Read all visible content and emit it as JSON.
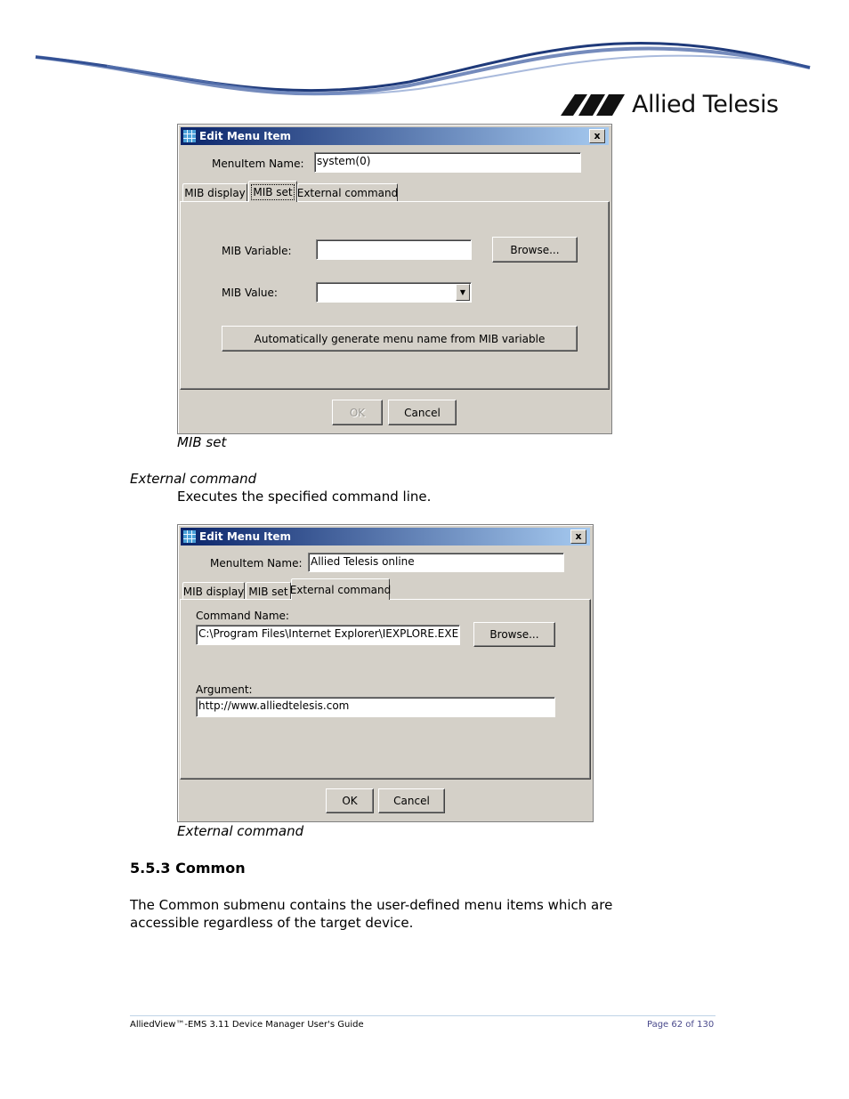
{
  "header": {
    "logo_text": "Allied Telesis"
  },
  "dialog1": {
    "title": "Edit Menu Item",
    "close_label": "x",
    "menuitem_label": "MenuItem Name:",
    "menuitem_value": "system(0)",
    "tabs": [
      "MIB display",
      "MIB set",
      "External command"
    ],
    "active_tab": "MIB set",
    "mib_variable_label": "MIB Variable:",
    "mib_variable_value": "",
    "browse_label": "Browse...",
    "mib_value_label": "MIB Value:",
    "mib_value_value": "",
    "auto_generate_label": "Automatically generate menu name from MIB variable",
    "ok_label": "OK",
    "cancel_label": "Cancel"
  },
  "caption1": "MIB set",
  "term": "External command",
  "term_description": "Executes the specified command line.",
  "dialog2": {
    "title": "Edit Menu Item",
    "close_label": "x",
    "menuitem_label": "MenuItem Name:",
    "menuitem_value": "Allied Telesis online",
    "tabs": [
      "MIB display",
      "MIB set",
      "External command"
    ],
    "active_tab": "External command",
    "command_name_label": "Command Name:",
    "command_name_value": "C:\\Program Files\\Internet Explorer\\IEXPLORE.EXE",
    "browse_label": "Browse...",
    "argument_label": "Argument:",
    "argument_value": "http://www.alliedtelesis.com",
    "ok_label": "OK",
    "cancel_label": "Cancel"
  },
  "caption2": "External command",
  "section": {
    "heading": "5.5.3 Common",
    "paragraph": "The Common submenu contains the user-defined menu items which are accessible regardless of the target device."
  },
  "footer": {
    "left": "AlliedView™-EMS 3.11 Device Manager User's Guide",
    "right": "Page 62 of 130"
  }
}
